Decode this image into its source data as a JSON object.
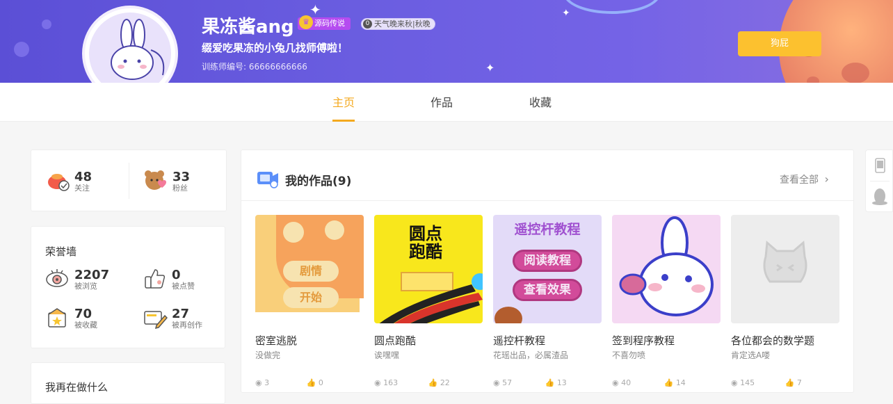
{
  "profile": {
    "username": "果冻酱ang",
    "badge": "源码传说",
    "tag_num": "0",
    "tag_text": "天气晚来秋|秋晚",
    "motto": "缀爱吃果冻的小兔几找师傅啦！",
    "trainer_label": "训练师编号: 66666666666",
    "follow_label": "狗屁"
  },
  "nav": {
    "tabs": [
      "主页",
      "作品",
      "收藏"
    ],
    "active": "主页"
  },
  "social": {
    "following_count": "48",
    "following_label": "关注",
    "fans_count": "33",
    "fans_label": "粉丝"
  },
  "honor": {
    "title": "荣誉墙",
    "items": [
      {
        "value": "2207",
        "label": "被浏览"
      },
      {
        "value": "0",
        "label": "被点赞"
      },
      {
        "value": "70",
        "label": "被收藏"
      },
      {
        "value": "27",
        "label": "被再创作"
      }
    ]
  },
  "next_card_title": "我再在做什么",
  "works": {
    "title": "我的作品(9)",
    "view_all": "查看全部",
    "items": [
      {
        "name": "密室逃脱",
        "desc": "没做完",
        "views": "3",
        "likes": "0",
        "thumb_text1": "剧情",
        "thumb_text2": "开始"
      },
      {
        "name": "圆点跑酷",
        "desc": "诶嘿嘿",
        "views": "163",
        "likes": "22",
        "thumb_text1": "圆点",
        "thumb_text2": "跑酷"
      },
      {
        "name": "遥控杆教程",
        "desc": "花瑶出品，必属渣品",
        "views": "57",
        "likes": "13",
        "thumb_text1": "遥控杆教程",
        "thumb_text2": "阅读教程",
        "thumb_text3": "查看效果"
      },
      {
        "name": "签到程序教程",
        "desc": "不喜勿喷",
        "views": "40",
        "likes": "14"
      },
      {
        "name": "各位都会的数学题",
        "desc": "肯定选A喽",
        "views": "145",
        "likes": "7"
      }
    ]
  },
  "colors": {
    "accent": "#f4a91f",
    "button": "#fcc12f",
    "banner": "#5b4fd6"
  }
}
